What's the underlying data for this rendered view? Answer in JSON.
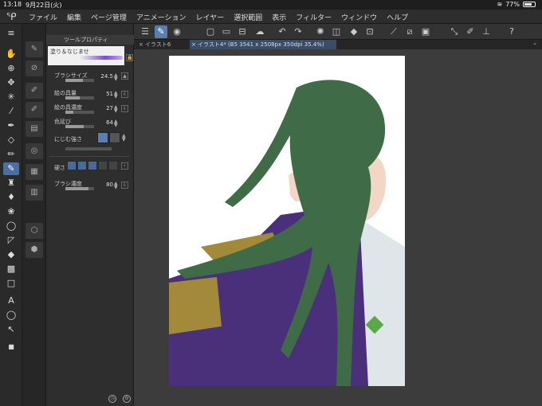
{
  "status": {
    "time": "13:18",
    "date": "9月22日(火)",
    "battery": "77%",
    "battery_level": 0.77
  },
  "menu": [
    "ファイル",
    "編集",
    "ページ管理",
    "アニメーション",
    "レイヤー",
    "選択範囲",
    "表示",
    "フィルター",
    "ウィンドウ",
    "ヘルプ"
  ],
  "panel": {
    "title": "ツールプロパティ",
    "preset": "塗り＆なじませ",
    "brush_size_label": "ブラシサイズ",
    "brush_size_value": "24.5",
    "paint_amount_label": "絵の具量",
    "paint_amount_value": "51",
    "paint_density_label": "絵の具濃度",
    "paint_density_value": "27",
    "color_stretch_label": "色延び",
    "color_stretch_value": "64",
    "blend_label": "にじむ強さ",
    "hardness_label": "硬さ",
    "brush_density_label": "ブラシ濃度",
    "brush_density_value": "80"
  },
  "tabs": [
    {
      "label": "イラスト6",
      "active": false
    },
    {
      "label": "イラスト4* (B5 3541 x 2508px 350dpi 35.4%)",
      "active": true
    }
  ],
  "colors": {
    "hair": "#3f6b46",
    "uniform": "#4a2f7a",
    "epaulette": "#a38a3a",
    "coat": "#dfe6ea",
    "skin": "#f3d7c6"
  }
}
